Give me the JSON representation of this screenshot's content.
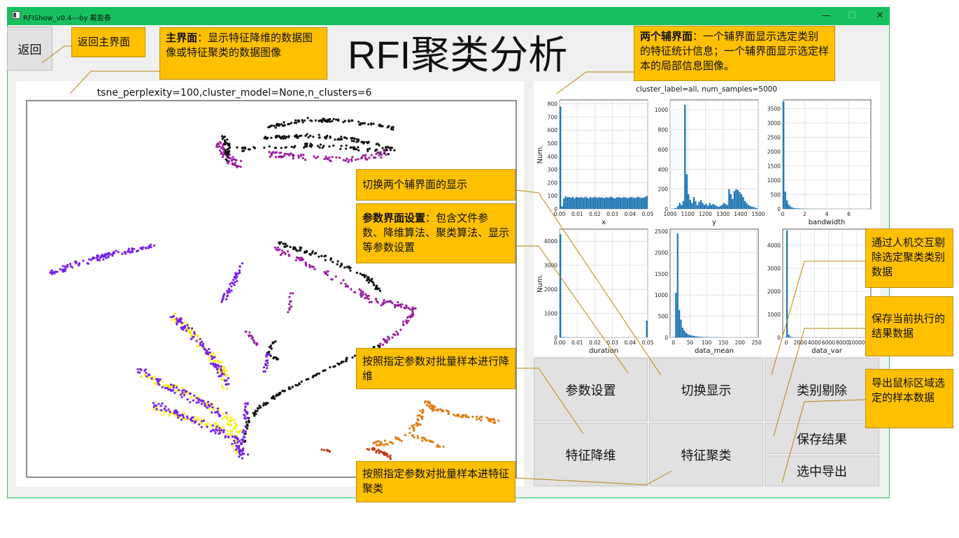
{
  "window": {
    "title": "RFIShow_v0.4---by 戴盈春",
    "controls": {
      "minimize": "—",
      "maximize": "☐",
      "close": "✕"
    }
  },
  "back_button": {
    "label": "返回"
  },
  "page_title": "RFI聚类分析",
  "main_plot": {
    "title": "tsne_perplexity=100,cluster_model=None,n_clusters=6"
  },
  "side_panel": {
    "title": "cluster_label=all, num_samples=5000",
    "ylabel": "Num.",
    "hist_color": "#1f77b4"
  },
  "chart_data": [
    {
      "type": "bar",
      "title": "",
      "xlabel": "x",
      "ylabel": "Num.",
      "xlim": [
        0,
        0.05
      ],
      "ylim": [
        0,
        830
      ],
      "x_ticks": [
        "0.00",
        "0.01",
        "0.02",
        "0.03",
        "0.04",
        "0.05"
      ],
      "y_ticks": [
        "0",
        "100",
        "200",
        "300",
        "400",
        "500",
        "600",
        "700",
        "800"
      ],
      "values": [
        780,
        20,
        80,
        95,
        88,
        90,
        85,
        92,
        80,
        90,
        88,
        86,
        90,
        84,
        92,
        88,
        80,
        90,
        86,
        88,
        92,
        84,
        90,
        86,
        88,
        82,
        90,
        86,
        88,
        92,
        84,
        80,
        88,
        90,
        86,
        84,
        90,
        88,
        82,
        86,
        90,
        88,
        84,
        86,
        92,
        88,
        84,
        86,
        90,
        100
      ]
    },
    {
      "type": "bar",
      "title": "",
      "xlabel": "y",
      "ylabel": "",
      "xlim": [
        1000,
        1500
      ],
      "ylim": [
        0,
        1100
      ],
      "x_ticks": [
        "1000",
        "1100",
        "1200",
        "1300",
        "1400",
        "1500"
      ],
      "y_ticks": [
        "0",
        "200",
        "400",
        "600",
        "800",
        "1000"
      ],
      "values": [
        0,
        0,
        5,
        10,
        30,
        60,
        40,
        80,
        1050,
        350,
        150,
        90,
        60,
        120,
        80,
        40,
        70,
        90,
        60,
        40,
        50,
        30,
        60,
        40,
        50,
        40,
        30,
        20,
        30,
        40,
        60,
        50,
        40,
        200,
        150,
        100,
        180,
        200,
        190,
        170,
        150,
        120,
        80,
        60,
        40,
        30,
        20,
        20,
        10,
        5
      ]
    },
    {
      "type": "bar",
      "title": "",
      "xlabel": "bandwidth",
      "ylabel": "",
      "xlim": [
        0,
        8
      ],
      "ylim": [
        0,
        3800
      ],
      "x_ticks": [
        "0",
        "2",
        "4",
        "6"
      ],
      "y_ticks": [
        "0",
        "500",
        "1000",
        "1500",
        "2000",
        "2500",
        "3000",
        "3500"
      ],
      "values": [
        3750,
        600,
        300,
        150,
        80,
        50,
        30,
        20,
        20,
        15,
        10,
        10,
        8,
        5,
        5,
        5,
        3,
        2,
        2,
        2,
        2,
        1,
        1,
        1,
        1,
        1,
        1,
        1,
        1,
        1,
        1,
        1,
        1,
        1,
        1,
        1,
        1,
        1,
        1,
        1,
        1,
        1,
        1,
        1,
        1,
        1,
        1,
        1,
        1,
        0
      ]
    },
    {
      "type": "bar",
      "title": "",
      "xlabel": "duration",
      "ylabel": "Num.",
      "xlim": [
        0,
        0.05
      ],
      "ylim": [
        0,
        4500
      ],
      "x_ticks": [
        "0.00",
        "0.01",
        "0.02",
        "0.03",
        "0.04",
        "0.05"
      ],
      "y_ticks": [
        "0",
        "1000",
        "2000",
        "3000",
        "4000"
      ],
      "values": [
        4300,
        20,
        15,
        10,
        8,
        6,
        5,
        4,
        3,
        3,
        2,
        2,
        2,
        2,
        1,
        1,
        1,
        1,
        1,
        1,
        1,
        1,
        1,
        1,
        1,
        1,
        1,
        1,
        1,
        1,
        1,
        1,
        1,
        1,
        1,
        1,
        1,
        1,
        1,
        1,
        1,
        1,
        1,
        1,
        1,
        1,
        1,
        1,
        1,
        700
      ]
    },
    {
      "type": "bar",
      "title": "",
      "xlabel": "data_mean",
      "ylabel": "",
      "xlim": [
        -10,
        255
      ],
      "ylim": [
        0,
        2550
      ],
      "x_ticks": [
        "0",
        "50",
        "100",
        "150",
        "200",
        "250"
      ],
      "y_ticks": [
        "0",
        "500",
        "1000",
        "1500",
        "2000",
        "2500"
      ],
      "values": [
        10,
        1050,
        2450,
        650,
        420,
        230,
        160,
        110,
        80,
        60,
        50,
        40,
        30,
        25,
        20,
        18,
        15,
        12,
        10,
        10,
        8,
        7,
        6,
        5,
        5,
        4,
        4,
        3,
        3,
        3,
        2,
        2,
        2,
        2,
        1,
        1,
        1,
        1,
        1,
        1,
        1,
        1,
        1,
        1,
        1,
        1,
        1,
        1,
        1,
        1
      ]
    },
    {
      "type": "bar",
      "title": "",
      "xlabel": "data_var",
      "ylabel": "",
      "xlim": [
        -500,
        12000
      ],
      "ylim": [
        0,
        4700
      ],
      "x_ticks": [
        "0",
        "2000",
        "4000",
        "6000",
        "8000",
        "10000"
      ],
      "y_ticks": [
        "0",
        "1000",
        "2000",
        "3000",
        "4000"
      ],
      "values": [
        4650,
        120,
        40,
        20,
        10,
        8,
        6,
        5,
        4,
        3,
        2,
        2,
        2,
        1,
        1,
        1,
        1,
        1,
        1,
        1,
        1,
        1,
        1,
        1,
        1,
        1,
        1,
        1,
        1,
        1,
        1,
        1,
        1,
        1,
        1,
        1,
        1,
        1,
        1,
        1,
        1,
        1,
        1,
        1,
        1,
        1,
        1,
        1,
        1,
        1
      ]
    }
  ],
  "buttons": {
    "params": "参数设置",
    "toggle": "切换显示",
    "remove_class": "类别剔除",
    "reduce": "特征降维",
    "cluster": "特征聚类",
    "save": "保存结果",
    "export": "选中导出"
  },
  "callouts": {
    "back": "返回主界面",
    "main_bold": "主界面",
    "main_text": "：显示特征降维的数据图像或特征聚类的数据图像",
    "aux_bold": "两个辅界面",
    "aux_text": "：一个辅界面显示选定类别的特征统计信息；一个辅界面显示选定样本的局部信息图像。",
    "toggle": "切换两个辅界面的显示",
    "params_bold": "参数界面设置",
    "params_text": "：包含文件参数、降维算法、聚类算法、显示等参数设置",
    "reduce": "按照指定参数对批量样本进行降维",
    "cluster": "按照指定参数对批量样本进特征聚类",
    "remove": "通过人机交互剔除选定聚类类别数据",
    "save": "保存当前执行的结果数据",
    "export": "导出鼠标区域选定的样本数据"
  },
  "scatter_colors": {
    "black": "#111111",
    "purple": "#9b1fa0",
    "violet": "#7a22e8",
    "yellow": "#f5ef1a",
    "orange": "#e07b12",
    "red": "#c0401a"
  }
}
